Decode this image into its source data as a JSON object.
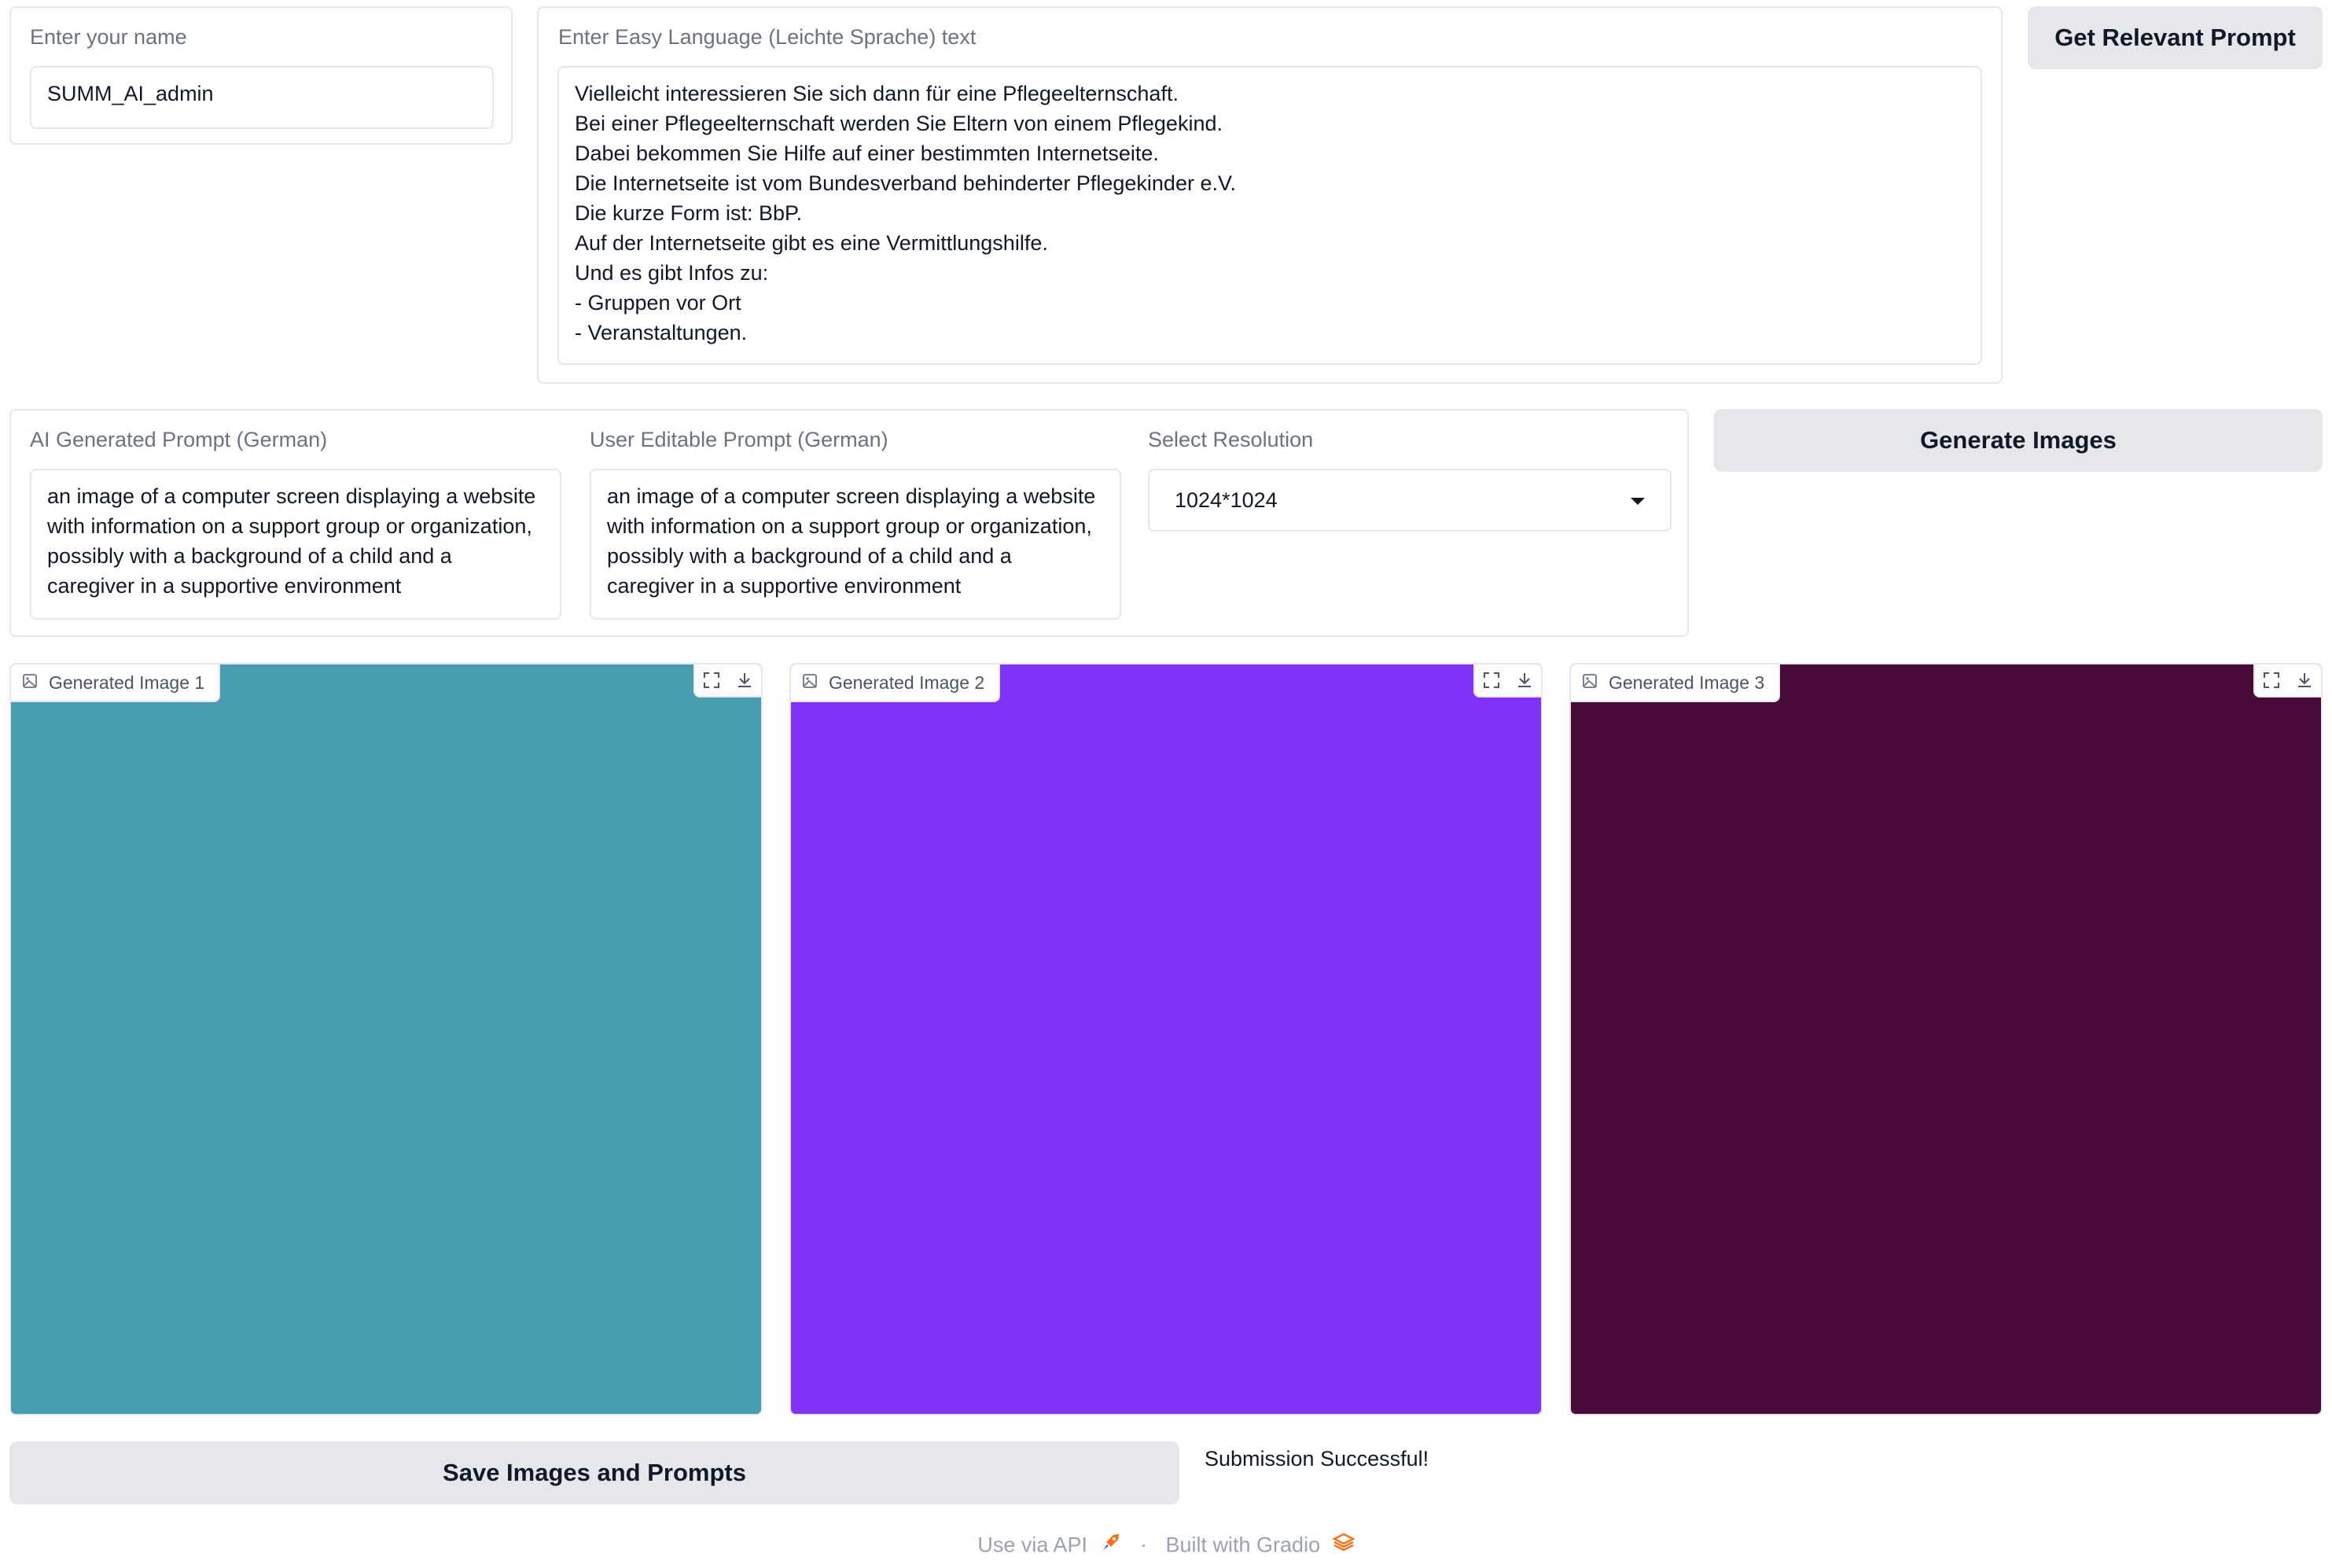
{
  "name_panel": {
    "label": "Enter your name",
    "value": "SUMM_AI_admin"
  },
  "text_panel": {
    "label": "Enter Easy Language (Leichte Sprache) text",
    "value": "Vielleicht interessieren Sie sich dann für eine Pflegeelternschaft.\nBei einer Pflegeelternschaft werden Sie Eltern von einem Pflegekind.\nDabei bekommen Sie Hilfe auf einer bestimmten Internetseite.\nDie Internetseite ist vom Bundesverband behinderter Pflegekinder e.V.\nDie kurze Form ist: BbP.\nAuf der Internetseite gibt es eine Vermittlungshilfe.\nUnd es gibt Infos zu:\n- Gruppen vor Ort\n- Veranstaltungen."
  },
  "get_prompt_button": "Get Relevant Prompt",
  "ai_prompt": {
    "label": "AI Generated Prompt (German)",
    "value": "an image of a computer screen displaying a website with information on a support group or organization, possibly with a background of a child and a caregiver in a supportive environment"
  },
  "user_prompt": {
    "label": "User Editable Prompt (German)",
    "value": "an image of a computer screen displaying a website with information on a support group or organization, possibly with a background of a child and a caregiver in a supportive environment"
  },
  "resolution": {
    "label": "Select Resolution",
    "selected": "1024*1024"
  },
  "generate_button": "Generate Images",
  "images": [
    {
      "label": "Generated Image 1",
      "color": "#489db1"
    },
    {
      "label": "Generated Image 2",
      "color": "#8133f6"
    },
    {
      "label": "Generated Image 3",
      "color": "#480b3a"
    }
  ],
  "save_button": "Save Images and Prompts",
  "status": "Submission Successful!",
  "footer": {
    "api": "Use via API",
    "separator": "·",
    "built": "Built with Gradio"
  }
}
